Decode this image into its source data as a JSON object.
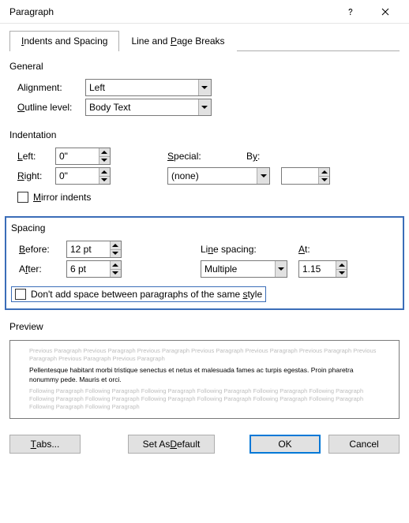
{
  "title": "Paragraph",
  "tabs": {
    "indents": {
      "pre": "",
      "accel": "I",
      "post": "ndents and Spacing"
    },
    "breaks": {
      "pre": "Line and ",
      "accel": "P",
      "post": "age Breaks"
    }
  },
  "general": {
    "legend": "General",
    "alignment_pre": "Ali",
    "alignment_accel": "g",
    "alignment_post": "nment:",
    "alignment_value": "Left",
    "outline_accel": "O",
    "outline_post": "utline level:",
    "outline_value": "Body Text"
  },
  "indentation": {
    "legend": "Indentation",
    "left_accel": "L",
    "left_post": "eft:",
    "left_value": "0\"",
    "right_accel": "R",
    "right_post": "ight:",
    "right_value": "0\"",
    "special_accel": "S",
    "special_post": "pecial:",
    "special_value": "(none)",
    "by_pre": "B",
    "by_accel": "y",
    "by_post": ":",
    "by_value": "",
    "mirror_accel": "M",
    "mirror_post": "irror indents"
  },
  "spacing": {
    "legend": "Spacing",
    "before_accel": "B",
    "before_post": "efore:",
    "before_value": "12 pt",
    "after_pre": "A",
    "after_accel": "f",
    "after_post": "ter:",
    "after_value": "6 pt",
    "line_pre": "Li",
    "line_accel": "n",
    "line_post": "e spacing:",
    "line_value": "Multiple",
    "at_accel": "A",
    "at_post": "t:",
    "at_value": "1.15",
    "noadd_pre": "Don't add space between paragraphs of the same ",
    "noadd_accel": "s",
    "noadd_post": "tyle"
  },
  "preview": {
    "legend": "Preview",
    "prev": "Previous Paragraph Previous Paragraph Previous Paragraph Previous Paragraph Previous Paragraph Previous Paragraph Previous Paragraph Previous Paragraph Previous Paragraph",
    "sample": "Pellentesque habitant morbi tristique senectus et netus et malesuada fames ac turpis egestas. Proin pharetra nonummy pede. Mauris et orci.",
    "next": "Following Paragraph Following Paragraph Following Paragraph Following Paragraph Following Paragraph Following Paragraph Following Paragraph Following Paragraph Following Paragraph Following Paragraph Following Paragraph Following Paragraph Following Paragraph Following Paragraph"
  },
  "buttons": {
    "tabs_accel": "T",
    "tabs_post": "abs...",
    "default_pre": "Set As ",
    "default_accel": "D",
    "default_post": "efault",
    "ok": "OK",
    "cancel": "Cancel"
  }
}
